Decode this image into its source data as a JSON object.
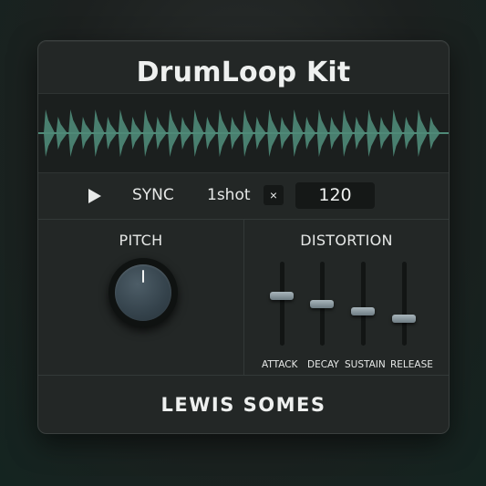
{
  "app": {
    "title": "DrumLoop Kit"
  },
  "waveform": {
    "color": "#4f8a78"
  },
  "transport": {
    "play_icon": "play-icon",
    "sync_label": "SYNC",
    "mode_label": "1shot",
    "close_symbol": "×",
    "bpm_value": "120"
  },
  "pitch": {
    "title": "PITCH",
    "knob_level": 0.5
  },
  "distortion": {
    "title": "DISTORTION",
    "sliders": [
      {
        "label": "ATTACK",
        "level": 0.6
      },
      {
        "label": "DECAY",
        "level": 0.5
      },
      {
        "label": "SUSTAIN",
        "level": 0.4
      },
      {
        "label": "RELEASE",
        "level": 0.3
      }
    ]
  },
  "footer": {
    "brand": "LEWIS SOMES"
  },
  "colors": {
    "accent": "#4f8a78",
    "panel": "#232726",
    "text": "#eef0ef"
  }
}
